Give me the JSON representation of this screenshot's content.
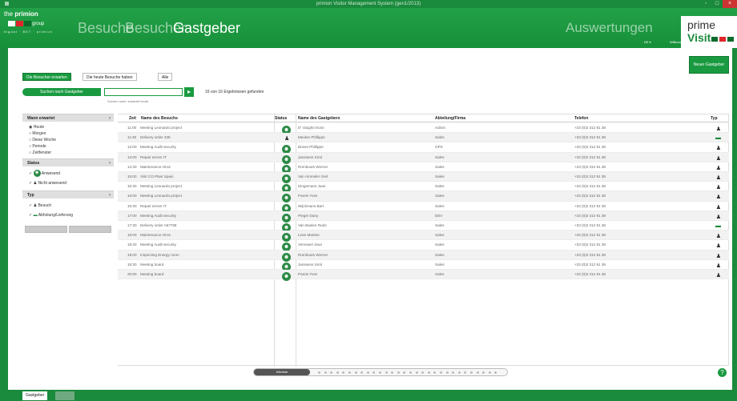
{
  "window": {
    "title": "primion Visitor Management System (gen1/2013)",
    "min": "-",
    "max": "□",
    "close": "×"
  },
  "logo": {
    "top_prefix": "the",
    "top_brand": "primion",
    "group": "group",
    "sub": "bigdat · BKT · primion"
  },
  "nav": {
    "besuche": "Besuche",
    "besucher": "Besucher",
    "gastgeber": "Gastgeber",
    "auswertungen": "Auswertungen"
  },
  "brand": {
    "name_a": "prime ",
    "name_b": "Visit",
    "lang": "DE",
    "welcome": "Willkommen in Deutschland"
  },
  "new_host_button": "Neuer Gastgeber",
  "tabs": [
    "Die Besucher erwarten",
    "Die heute Besuche haben",
    "Alle"
  ],
  "search": {
    "button_label": "Suchen nach Gastgeber",
    "value": "",
    "go": "▸",
    "result_count": "16 von 16 Ergebnissen gefunden",
    "hint": "Suchen nach: erwartet heute"
  },
  "filters": {
    "wann": {
      "title": "Wann erwartet",
      "arrow": "›",
      "options": [
        "Heute",
        "Morgen",
        "Diese Woche",
        "Periode",
        "Zeitfenster"
      ]
    },
    "status": {
      "title": "Status",
      "arrow": "›",
      "options": [
        "Anwesend",
        "Nicht anwesend"
      ]
    },
    "typ": {
      "title": "Typ",
      "arrow": "›",
      "options": [
        "Besuch",
        "Abholung/Lieferung"
      ]
    }
  },
  "table": {
    "columns": [
      "Zeit",
      "Name des Besuchs",
      "Status",
      "Name des Gastgebers",
      "Abteilung/Firma",
      "Telefon",
      "Typ"
    ],
    "rows": [
      {
        "time": "11:00",
        "name": "Meeting Leonardo project",
        "status": "present",
        "host": "D' Vaughn Evan",
        "dept": "Admin",
        "phone": "+33 (0)3 312 91 38",
        "type": "person"
      },
      {
        "time": "11:30",
        "name": "Delivery order 438",
        "status": "plain",
        "host": "Meulen Phillippe",
        "dept": "Sales",
        "phone": "+33 (0)3 312 91 38",
        "type": "car"
      },
      {
        "time": "12:00",
        "name": "Meeting Audit security",
        "status": "present",
        "host": "Brown Phillippe",
        "dept": "OPS",
        "phone": "+33 (0)3 312 91 38",
        "type": "person"
      },
      {
        "time": "13:00",
        "name": "Repair server IT",
        "status": "present",
        "host": "Janssens Smit",
        "dept": "Sales",
        "phone": "+33 (0)3 312 91 38",
        "type": "person"
      },
      {
        "time": "14:30",
        "name": "Maintenance Alros",
        "status": "present",
        "host": "Rombouts Werner",
        "dept": "Sales",
        "phone": "+33 (0)3 312 91 38",
        "type": "person"
      },
      {
        "time": "15:00",
        "name": "Visit CO Plant Spain",
        "status": "present",
        "host": "Van Ammeler Gert",
        "dept": "Sales",
        "phone": "+33 (0)3 312 91 38",
        "type": "person"
      },
      {
        "time": "15:30",
        "name": "Meeting Leonardo project",
        "status": "present",
        "host": "Dingemans Juan",
        "dept": "Sales",
        "phone": "+33 (0)3 312 91 38",
        "type": "person"
      },
      {
        "time": "16:00",
        "name": "Meeting Leonardo project",
        "status": "present",
        "host": "Pareis Yves",
        "dept": "Sales",
        "phone": "+33 (0)3 312 91 38",
        "type": "person"
      },
      {
        "time": "16:30",
        "name": "Repair server IT",
        "status": "present",
        "host": "Wijckmans Bart",
        "dept": "Sales",
        "phone": "+33 (0)3 312 91 38",
        "type": "person"
      },
      {
        "time": "17:00",
        "name": "Meeting Audit security",
        "status": "present",
        "host": "Pieger Dany",
        "dept": "DEV",
        "phone": "+33 (0)3 312 91 38",
        "type": "person"
      },
      {
        "time": "17:30",
        "name": "Delivery order A87788",
        "status": "present",
        "host": "Van Baelen Rudo",
        "dept": "Sales",
        "phone": "+33 (0)3 312 91 38",
        "type": "car"
      },
      {
        "time": "18:00",
        "name": "Maintenance Alros",
        "status": "present",
        "host": "Lean Martine",
        "dept": "Sales",
        "phone": "+33 (0)3 312 91 38",
        "type": "person"
      },
      {
        "time": "18:30",
        "name": "Meeting Audit security",
        "status": "present",
        "host": "Verreaert Jean",
        "dept": "Sales",
        "phone": "+33 (0)3 312 91 38",
        "type": "person"
      },
      {
        "time": "19:00",
        "name": "Inspecting Energy room",
        "status": "present",
        "host": "Rombouts Werner",
        "dept": "Sales",
        "phone": "+33 (0)3 312 91 38",
        "type": "person"
      },
      {
        "time": "19:30",
        "name": "Meeting board",
        "status": "present",
        "host": "Janssens Smit",
        "dept": "Sales",
        "phone": "+33 (0)3 312 91 38",
        "type": "person"
      },
      {
        "time": "20:00",
        "name": "Meeting board",
        "status": "present",
        "host": "Pareis Yves",
        "dept": "Sales",
        "phone": "+33 (0)3 312 91 38",
        "type": "person"
      }
    ]
  },
  "pager": {
    "button_label": "Nächste"
  },
  "help": "?",
  "taskbar": {
    "tab_label": "Gastgeber"
  }
}
